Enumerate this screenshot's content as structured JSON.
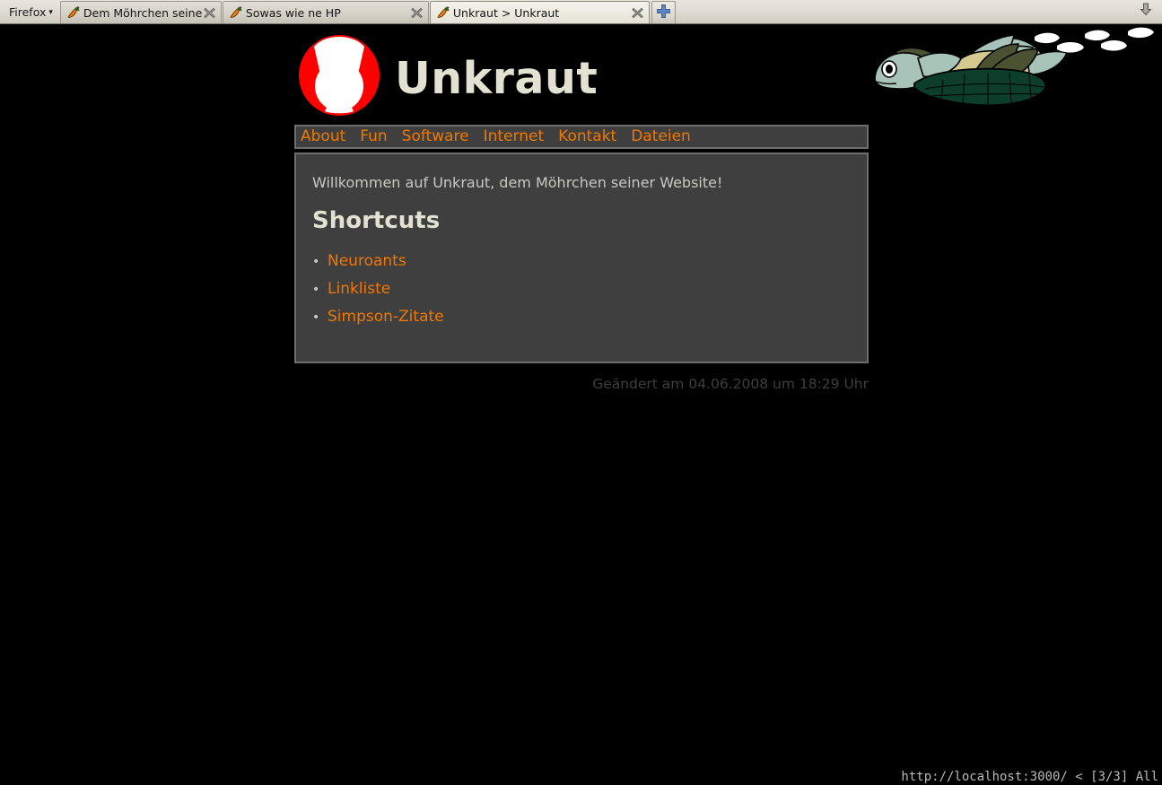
{
  "browser": {
    "menu_label": "Firefox",
    "menu_caret": "▾",
    "tabs": [
      {
        "title": "Dem Möhrchen seine Website",
        "favicon": "carrot-icon",
        "close": "close-icon",
        "active": false
      },
      {
        "title": "Sowas wie ne HP",
        "favicon": "carrot-icon",
        "close": "close-icon",
        "active": false
      },
      {
        "title": "Unkraut > Unkraut",
        "favicon": "carrot-icon",
        "close": "close-icon",
        "active": true
      }
    ],
    "new_tab_icon": "plus-icon",
    "downloads_icon": "download-arrow-icon"
  },
  "site": {
    "logo_alt": "unkraut-logo-icon",
    "title": "Unkraut",
    "turtle_alt": "sea-turtle-graphic",
    "nav": [
      {
        "label": "About"
      },
      {
        "label": "Fun"
      },
      {
        "label": "Software"
      },
      {
        "label": "Internet"
      },
      {
        "label": "Kontakt"
      },
      {
        "label": "Dateien"
      }
    ],
    "welcome": "Willkommen auf Unkraut, dem Möhrchen seiner Website!",
    "shortcuts_heading": "Shortcuts",
    "shortcuts": [
      {
        "label": "Neuroants"
      },
      {
        "label": "Linkliste"
      },
      {
        "label": "Simpson-Zitate"
      }
    ],
    "modified": "Geändert am 04.06.2008 um 18:29 Uhr"
  },
  "statusbar": {
    "text": "http://localhost:3000/ < [3/3] All"
  },
  "colors": {
    "page_background": "#000000",
    "accent_link": "#f07800",
    "panel_background": "#3f3f3f",
    "panel_border": "#6e6e6e",
    "title_text": "#e3e2d2",
    "body_text": "#c7c8bf",
    "logo_red": "#ff0000",
    "turtle_shell": "#0d3d2b",
    "turtle_body": "#d6c98e",
    "turtle_skin": "#a8c4b8"
  }
}
